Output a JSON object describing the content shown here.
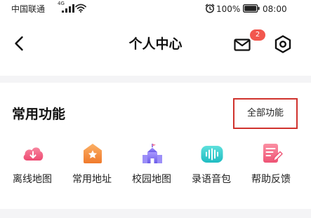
{
  "status_bar": {
    "carrier": "中国联通",
    "network_type": "4G",
    "battery_percent": "100%",
    "battery_level": 1.0,
    "time": "08:00",
    "icons": [
      "signal-icon",
      "wifi-icon",
      "alarm-icon",
      "battery-icon"
    ]
  },
  "nav": {
    "title": "个人中心",
    "back_icon": "chevron-left-icon",
    "mail_icon": "mail-icon",
    "mail_badge": "2",
    "settings_icon": "settings-icon"
  },
  "features": {
    "title": "常用功能",
    "all_link": "全部功能",
    "items": [
      {
        "label": "离线地图",
        "icon": "cloud-download-icon",
        "color": "#f05a7e"
      },
      {
        "label": "常用地址",
        "icon": "home-star-icon",
        "color": "#f38a3a"
      },
      {
        "label": "校园地图",
        "icon": "school-building-icon",
        "color": "#7a6cf0"
      },
      {
        "label": "录语音包",
        "icon": "voice-wave-icon",
        "color": "#2ec8c8"
      },
      {
        "label": "帮助反馈",
        "icon": "feedback-edit-icon",
        "color": "#f0607a"
      }
    ]
  },
  "colors": {
    "page_background": "#f4f4f6",
    "card_background": "#ffffff",
    "badge": "#f2574e",
    "highlight_border": "#d0322d"
  }
}
